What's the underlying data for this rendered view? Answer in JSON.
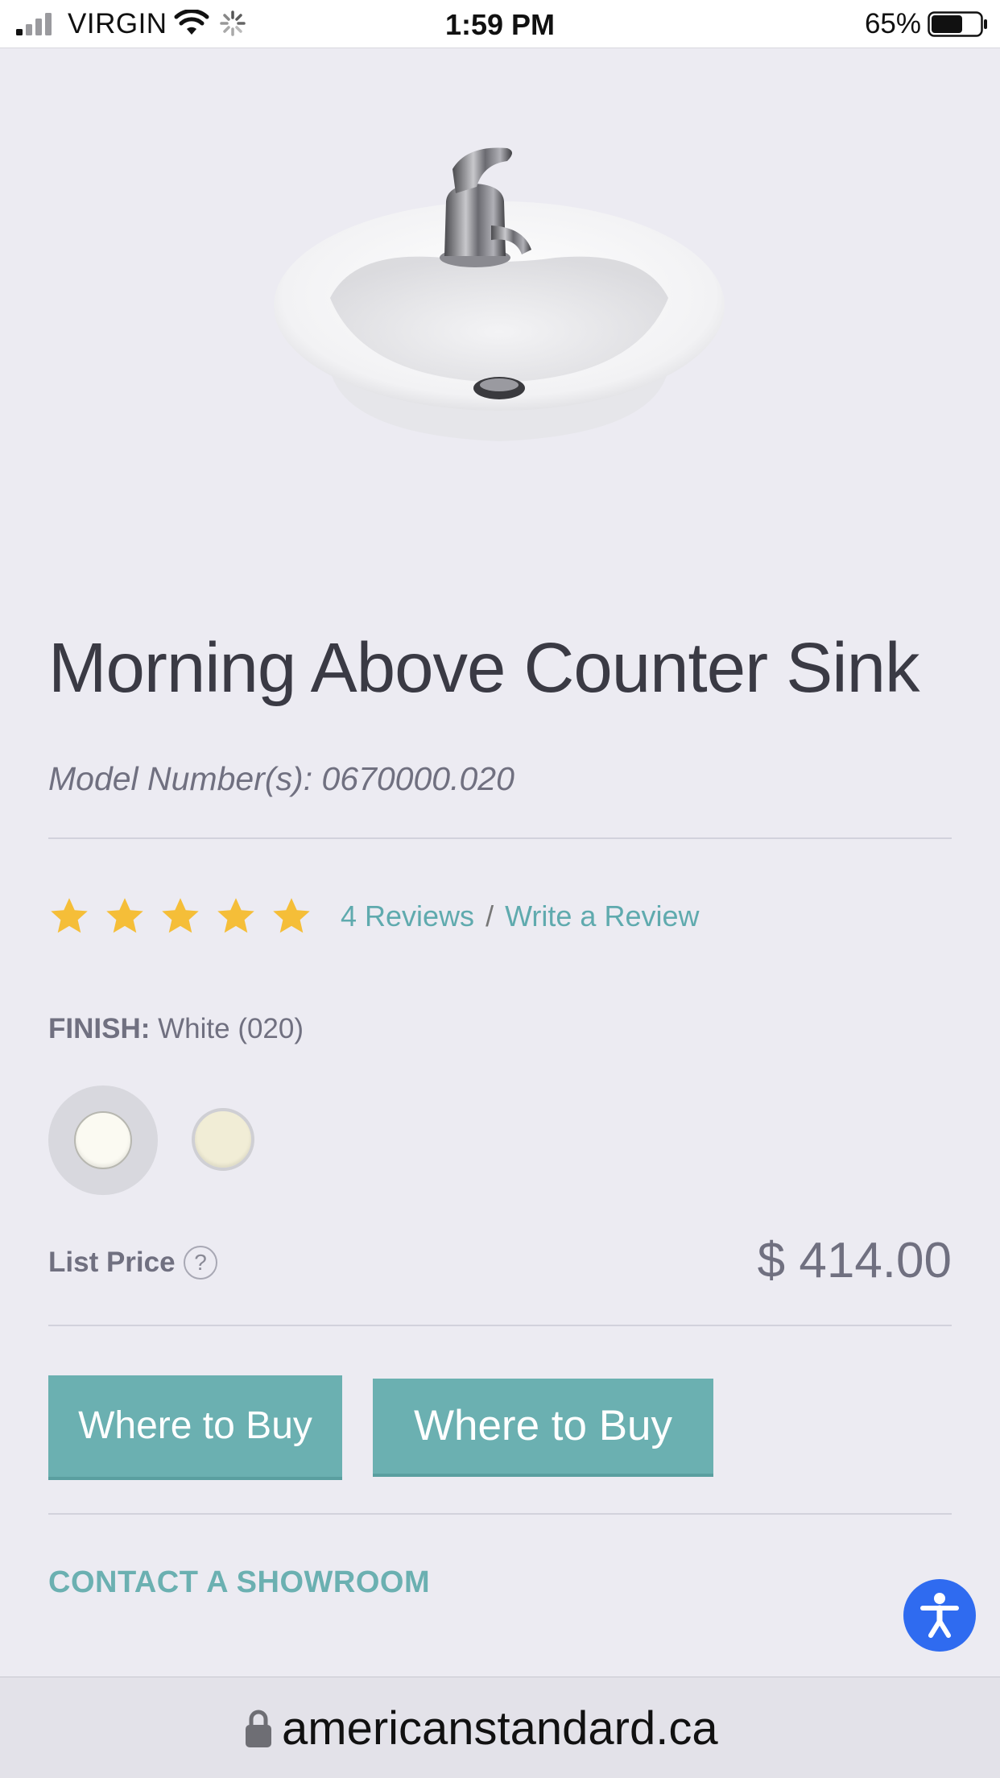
{
  "status_bar": {
    "carrier": "VIRGIN",
    "time": "1:59 PM",
    "battery_percent": "65%",
    "battery_level": 0.65,
    "icons": [
      "signal-icon",
      "wifi-icon",
      "loading-spinner-icon",
      "battery-icon"
    ]
  },
  "product": {
    "image_alt": "sink-with-faucet-image",
    "title": "Morning Above Counter Sink",
    "model_line": "Model Number(s): 0670000.020",
    "rating_stars": 5,
    "reviews_link": "4 Reviews",
    "reviews_separator": "/",
    "write_review_link": "Write a Review",
    "finish_label": "FINISH:",
    "finish_value": "White (020)",
    "swatches": [
      {
        "name": "white",
        "color": "#FBFAF2",
        "selected": true
      },
      {
        "name": "bone",
        "color": "#F1EDD6",
        "selected": false
      }
    ],
    "price_label": "List Price",
    "price_help": "?",
    "price_value": "$ 414.00"
  },
  "actions": {
    "where_to_buy_1": "Where to Buy",
    "where_to_buy_2": "Where to Buy",
    "contact_showroom": "CONTACT A SHOWROOM"
  },
  "url_bar": {
    "url": "americanstandard.ca"
  },
  "colors": {
    "accent": "#6BB0B1",
    "link": "#5FAAAE",
    "star": "#F5BE38",
    "accessibility": "#2F6BF0",
    "background": "#ECEBF2"
  }
}
